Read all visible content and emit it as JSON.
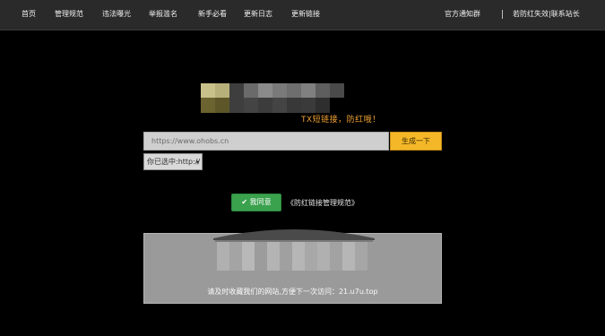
{
  "nav": {
    "items": [
      "首页",
      "管理规范",
      "违法曝光",
      "举报滥名",
      "新手必看",
      "更新日志",
      "更新链接"
    ],
    "official_group": "官方通知群",
    "contact": "若防红失效|联系站长"
  },
  "hero": {
    "slogan": "TX短链接，防红哦！"
  },
  "form": {
    "url_placeholder": "https://www.ohobs.cn",
    "generate_label": "生成一下",
    "protocol_selected": "你已选中:http://"
  },
  "agreement": {
    "agree_label": "我同意",
    "rules_link": "《防红链接管理规范》"
  },
  "notice": {
    "text": "请及时收藏我们的网站,方便下一次访问：21.u7u.top"
  },
  "colors": {
    "topbar_bg": "#2a2a2a",
    "generate_bg": "#f4b728",
    "agree_bg": "#3aa14d",
    "slogan": "#f0a233",
    "panel_bg": "#9a9a9a"
  },
  "icons": {
    "agree": "check-icon",
    "select": "caret-down-icon"
  }
}
